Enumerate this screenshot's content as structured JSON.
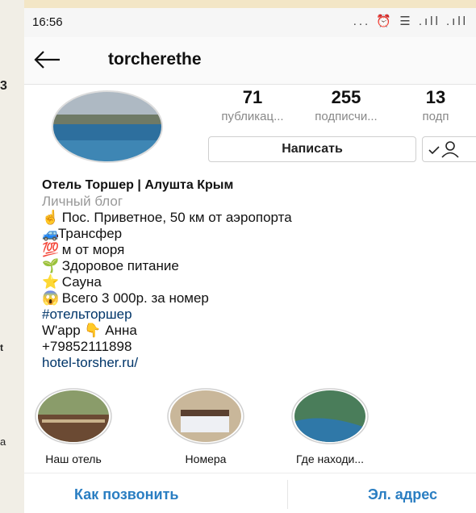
{
  "left_fragment": {
    "digit": "3",
    "letter": "t",
    "char": "a"
  },
  "status_bar": {
    "time": "16:56",
    "icons": "... ⏰ ☰ .ıll .ıll"
  },
  "header": {
    "username": "torcherethe"
  },
  "stats": [
    {
      "num": "71",
      "label": "публикац..."
    },
    {
      "num": "255",
      "label": "подписчи..."
    },
    {
      "num": "13",
      "label": "подп"
    }
  ],
  "buttons": {
    "message": "Написать"
  },
  "bio": {
    "name": "Отель Торшер | Алушта Крым",
    "category": "Личный блог",
    "lines": [
      {
        "emoji": "☝",
        "text": "Пос. Приветное, 50 км от аэропорта"
      },
      {
        "emoji": "🚙",
        "text": "Трансфер"
      },
      {
        "emoji": "💯",
        "text": "м от моря"
      },
      {
        "emoji": "🌱",
        "text": "Здоровое питание"
      },
      {
        "emoji": "⭐",
        "text": "Сауна"
      },
      {
        "emoji": "😱",
        "text": "Всего 3 000р. за номер"
      }
    ],
    "hashtag": "#отельторшер",
    "whatsapp": "W'app 👇 Анна",
    "phone": "+79852111898",
    "website": "hotel-torsher.ru/"
  },
  "highlights": [
    {
      "label": "Наш отель"
    },
    {
      "label": "Номера"
    },
    {
      "label": "Где находи..."
    }
  ],
  "actions": {
    "call": "Как позвонить",
    "email": "Эл. адрес"
  }
}
